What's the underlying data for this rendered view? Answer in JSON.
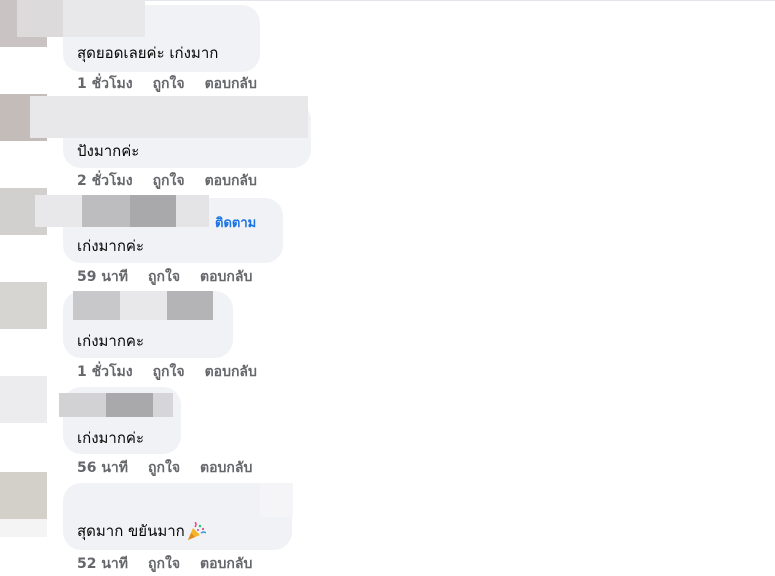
{
  "comments": [
    {
      "text": "สุดยอดเลยค่ะ เก่งมาก",
      "time": "1 ชั่วโมง",
      "like": "ถูกใจ",
      "reply": "ตอบกลับ"
    },
    {
      "text": "ปังมากค่ะ",
      "time": "2 ชั่วโมง",
      "like": "ถูกใจ",
      "reply": "ตอบกลับ"
    },
    {
      "text": "เก่งมากค่ะ",
      "follow": "ติดตาม",
      "time": "59 นาที",
      "like": "ถูกใจ",
      "reply": "ตอบกลับ"
    },
    {
      "text": "เก่งมากคะ",
      "time": "1 ชั่วโมง",
      "like": "ถูกใจ",
      "reply": "ตอบกลับ"
    },
    {
      "text": "เก่งมากค่ะ",
      "time": "56 นาที",
      "like": "ถูกใจ",
      "reply": "ตอบกลับ"
    },
    {
      "text": "สุดมาก ขยันมาก",
      "emoji": "party-popper-icon",
      "time": "52 นาที",
      "like": "ถูกใจ",
      "reply": "ตอบกลับ"
    }
  ],
  "colors": {
    "bubble": "#f0f2f5",
    "action_text": "#65676b",
    "follow_link": "#1b74e4",
    "comment_text": "#050505"
  }
}
